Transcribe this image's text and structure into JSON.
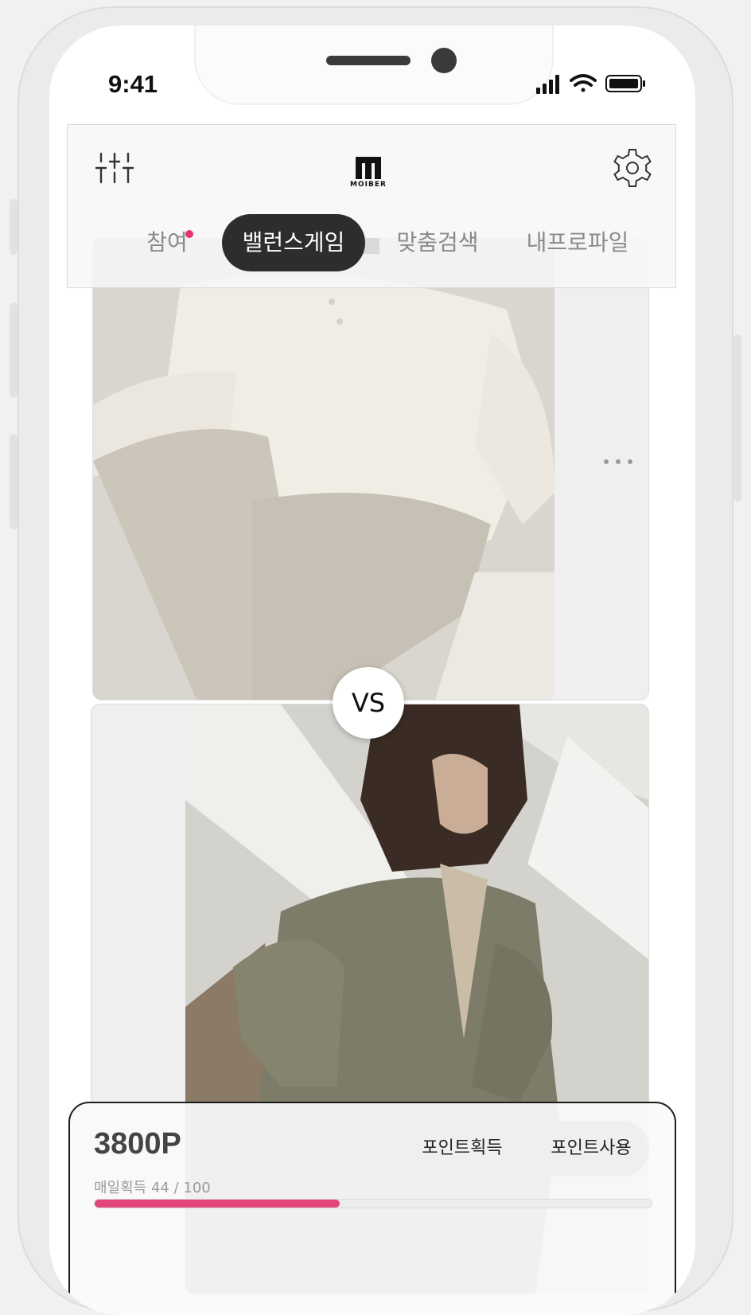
{
  "status_bar": {
    "time": "9:41"
  },
  "header": {
    "brand": "MOIBER",
    "tabs": [
      {
        "label": "참여",
        "has_notification": true
      },
      {
        "label": "밸런스게임",
        "active": true
      },
      {
        "label": "맞춤검색"
      },
      {
        "label": "내프로파일"
      }
    ]
  },
  "game": {
    "vs_label": "VS"
  },
  "points": {
    "total": "3800P",
    "earn_label": "포인트획득",
    "use_label": "포인트사용",
    "daily_label": "매일획득 44 / 100",
    "daily_progress": 0.44
  },
  "colors": {
    "accent": "#e2457a",
    "tab_active_bg": "#2d2d2d",
    "notification_dot": "#e8336e"
  }
}
